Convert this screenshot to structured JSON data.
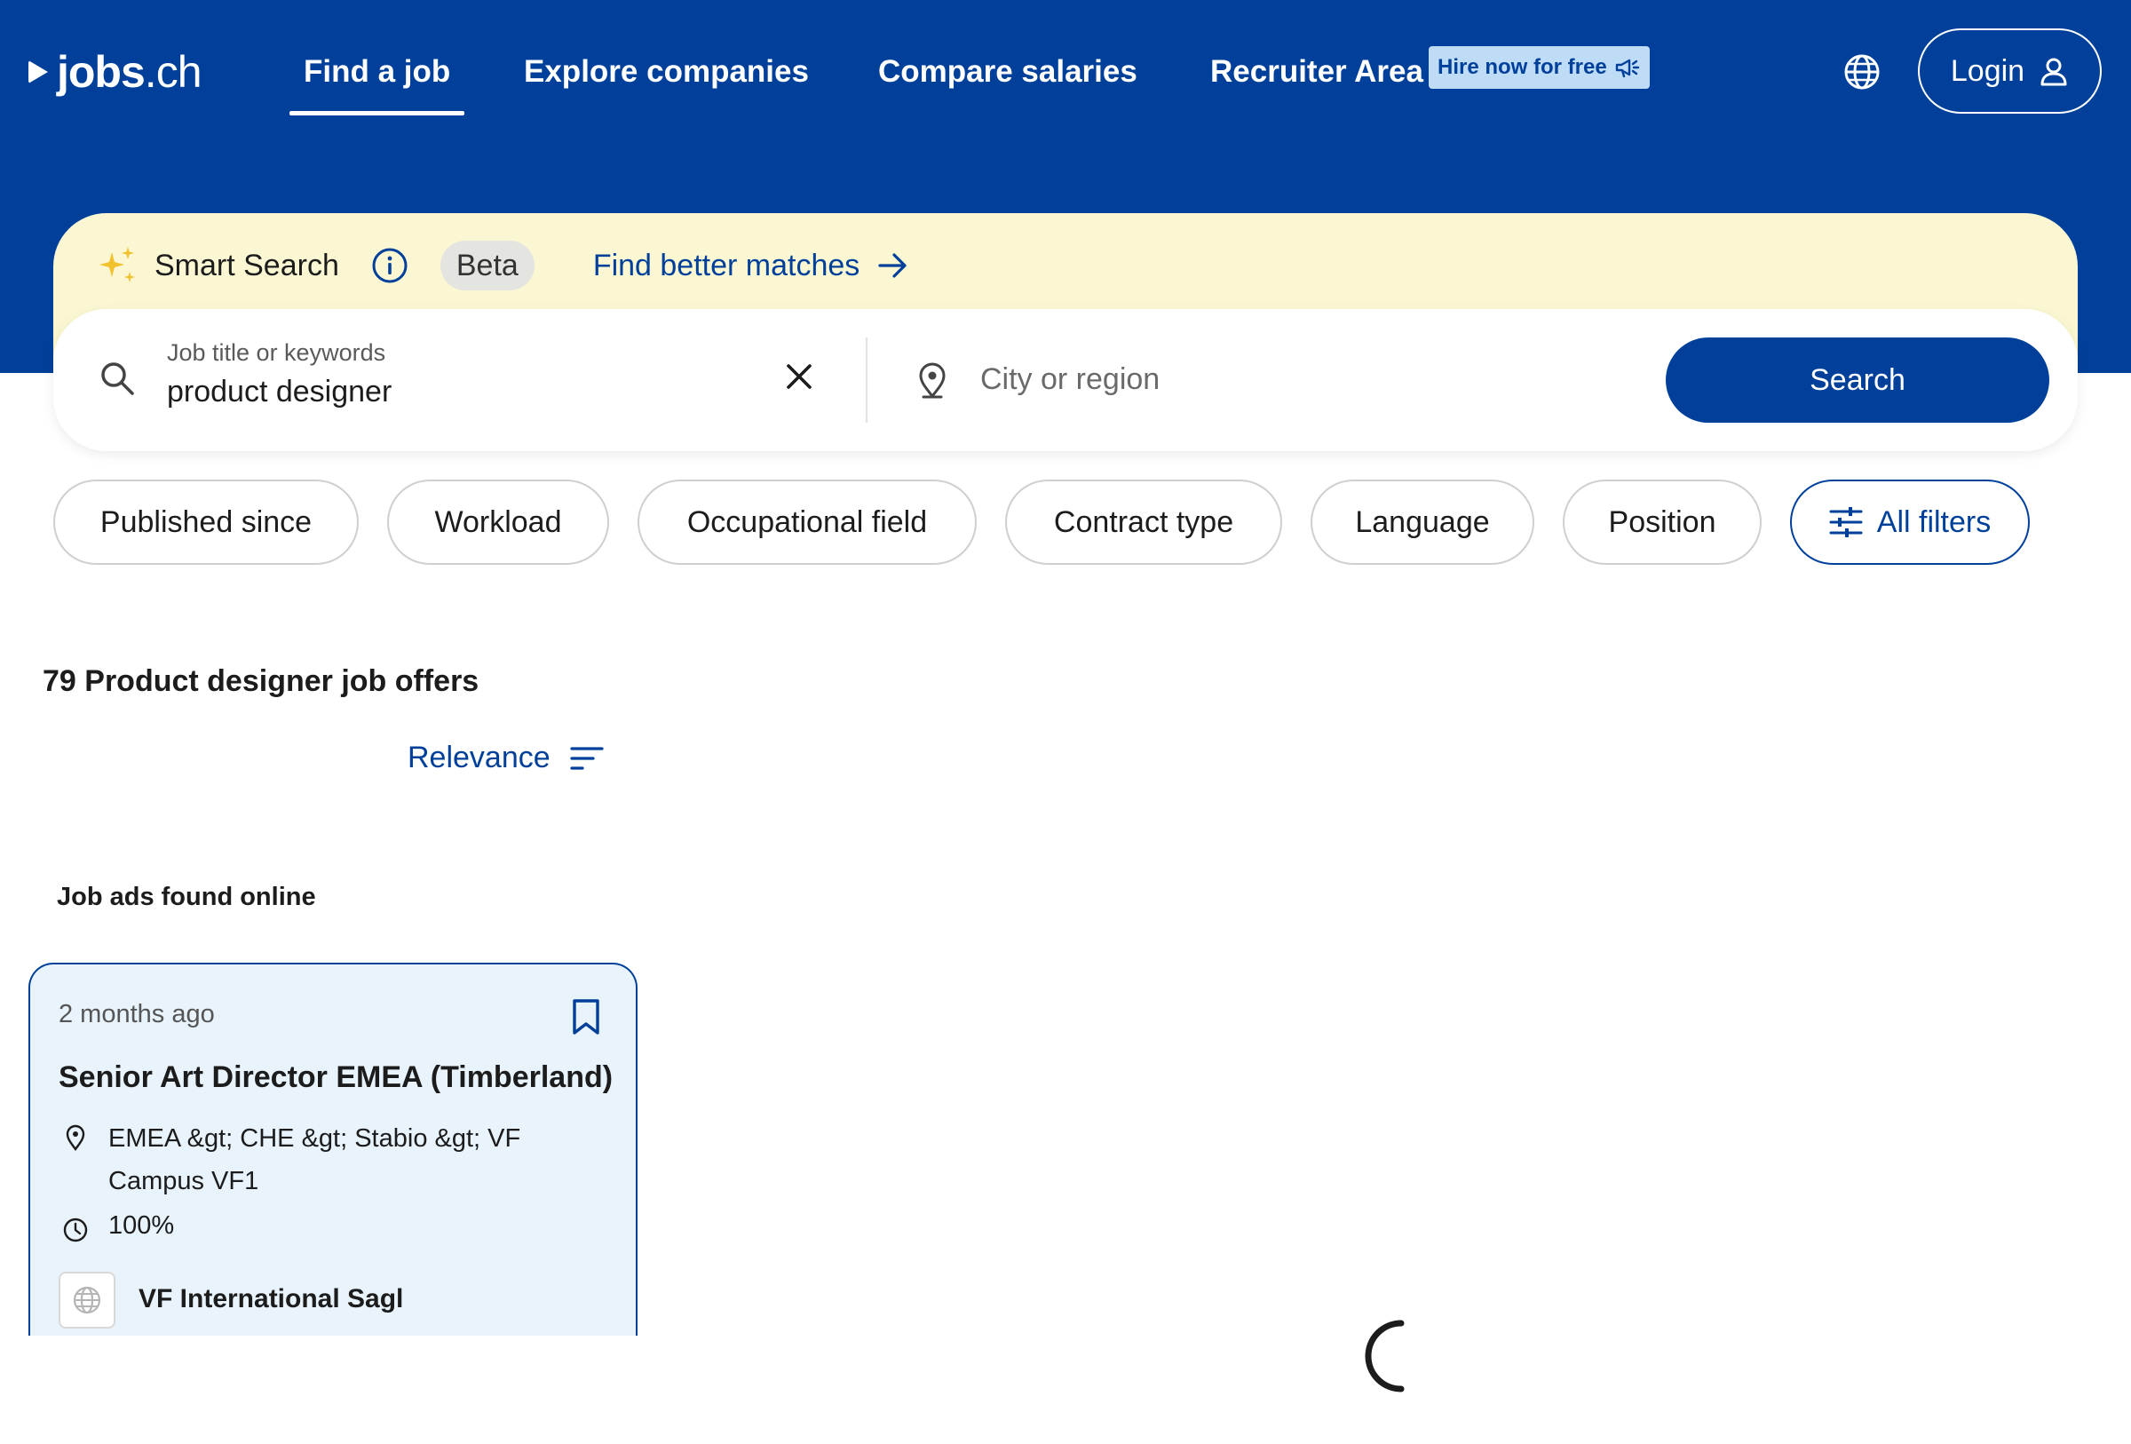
{
  "brand": {
    "logo_bold": "jobs",
    "logo_light": ".ch"
  },
  "nav": {
    "find_job": "Find a job",
    "explore_companies": "Explore companies",
    "compare_salaries": "Compare salaries",
    "recruiter_area": "Recruiter Area",
    "hire_badge": "Hire now for free",
    "login": "Login"
  },
  "smart_search": {
    "label": "Smart Search",
    "beta": "Beta",
    "better_matches": "Find better matches"
  },
  "search": {
    "keyword_label": "Job title or keywords",
    "keyword_value": "product designer",
    "city_placeholder": "City or region",
    "city_value": "",
    "button": "Search"
  },
  "filters": [
    "Published since",
    "Workload",
    "Occupational field",
    "Contract type",
    "Language",
    "Position"
  ],
  "all_filters": "All filters",
  "results": {
    "title": "79 Product designer job offers",
    "sort_label": "Relevance",
    "section_label": "Job ads found online"
  },
  "job": {
    "time": "2 months ago",
    "title": "Senior Art Director EMEA (Timberland)",
    "location": "EMEA &gt; CHE &gt; Stabio &gt; VF Campus VF1",
    "workload": "100%",
    "company": "VF International Sagl"
  },
  "colors": {
    "brand_blue": "#00409a",
    "smart_bg": "#fcf7d3",
    "card_bg": "#e8f3fc",
    "badge_bg": "#bfdcf7",
    "sparkle_yellow": "#f2c12e"
  }
}
